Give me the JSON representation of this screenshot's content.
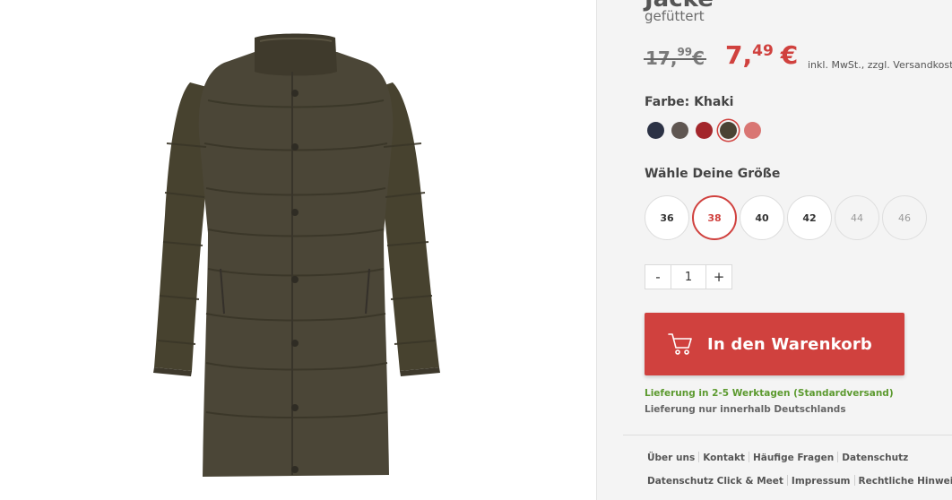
{
  "product": {
    "title_partial": "Jacke",
    "subtitle": "gefüttert"
  },
  "price": {
    "old_main": "17,",
    "old_cents": "99",
    "old_currency": "€",
    "new_main": "7,",
    "new_cents": "49",
    "new_currency": "€",
    "tax_note": "inkl. MwSt., zzgl. Versandkosten"
  },
  "color": {
    "label": "Farbe: Khaki",
    "swatches": [
      {
        "name": "navy",
        "hex": "#2c3245",
        "selected": false
      },
      {
        "name": "taupe",
        "hex": "#5f5651",
        "selected": false
      },
      {
        "name": "red",
        "hex": "#a3262b",
        "selected": false
      },
      {
        "name": "khaki",
        "hex": "#4a4334",
        "selected": true
      },
      {
        "name": "rose",
        "hex": "#d97673",
        "selected": false
      }
    ]
  },
  "size": {
    "label": "Wähle Deine Größe",
    "options": [
      {
        "value": "36",
        "state": "available"
      },
      {
        "value": "38",
        "state": "selected"
      },
      {
        "value": "40",
        "state": "available"
      },
      {
        "value": "42",
        "state": "available"
      },
      {
        "value": "44",
        "state": "disabled"
      },
      {
        "value": "46",
        "state": "disabled"
      }
    ]
  },
  "quantity": {
    "minus": "-",
    "value": "1",
    "plus": "+"
  },
  "cart": {
    "label": "In den Warenkorb",
    "icon": "cart-icon"
  },
  "delivery": {
    "line1": "Lieferung in 2-5 Werktagen (Standardversand)",
    "line2": "Lieferung nur innerhalb Deutschlands"
  },
  "footer": {
    "links_row1": [
      "Über uns",
      "Kontakt",
      "Häufige Fragen",
      "Datenschutz"
    ],
    "links_row2": [
      "Datenschutz Click & Meet",
      "Impressum",
      "Rechtliche Hinweise"
    ]
  },
  "colors": {
    "accent": "#d0413e",
    "delivery_green": "#5c9a2f",
    "panel_bg": "#f4f4f4",
    "coat": "#4b4637"
  }
}
